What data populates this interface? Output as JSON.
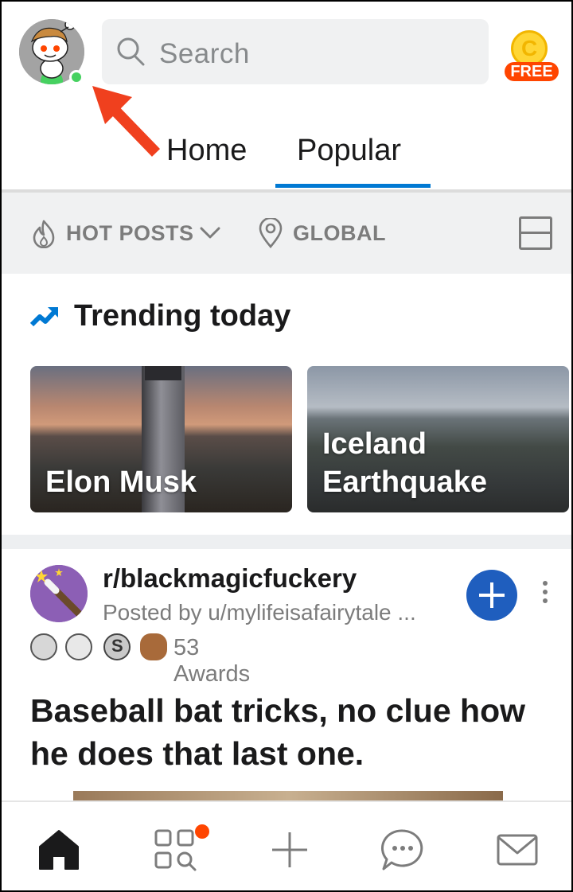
{
  "header": {
    "search_placeholder": "Search",
    "coin_label": "FREE",
    "coin_symbol": "C",
    "tabs": [
      {
        "label": "Home",
        "active": false
      },
      {
        "label": "Popular",
        "active": true
      }
    ]
  },
  "sortbar": {
    "sort_label": "HOT POSTS",
    "location_label": "GLOBAL"
  },
  "trending": {
    "title": "Trending today",
    "cards": [
      {
        "label": "Elon Musk"
      },
      {
        "label_line1": "Iceland",
        "label_line2": "Earthquake"
      }
    ]
  },
  "post": {
    "subreddit": "r/blackmagicfuckery",
    "posted_by": "Posted by u/mylifeisafairytale ...",
    "award_count": "53 Awards",
    "title": "Baseball bat tricks, no clue how he does that last one."
  },
  "colors": {
    "accent": "#0079d3",
    "join_button": "#1f5ebe",
    "orange": "#ff4500",
    "online": "#46d160"
  },
  "icons": [
    "search-icon",
    "flame-icon",
    "chevron-down-icon",
    "location-pin-icon",
    "card-layout-icon",
    "trending-arrow-icon",
    "plus-icon",
    "more-vertical-icon",
    "home-icon",
    "browse-icon",
    "create-icon",
    "chat-icon",
    "inbox-icon"
  ]
}
